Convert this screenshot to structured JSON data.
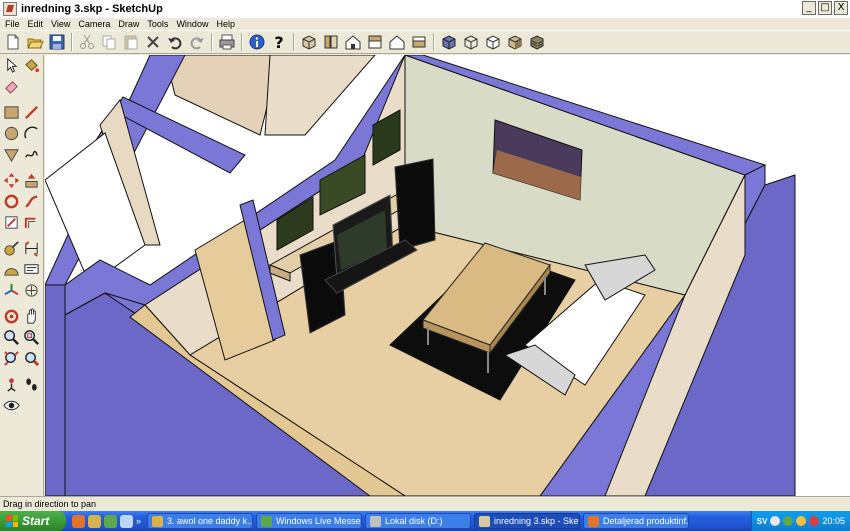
{
  "window": {
    "title": "inredning 3.skp - SketchUp",
    "controls": {
      "minimize": "_",
      "maximize": "□",
      "close": "X"
    }
  },
  "menu": [
    "File",
    "Edit",
    "View",
    "Camera",
    "Draw",
    "Tools",
    "Window",
    "Help"
  ],
  "toolbar": {
    "buttons": [
      "new-icon",
      "open-icon",
      "save-icon",
      "cut-icon",
      "copy-icon",
      "paste-icon",
      "erase-icon",
      "undo-icon",
      "redo-icon",
      "print-icon",
      "model-info-icon",
      "help-icon",
      "iso-view-icon",
      "top-view-icon",
      "front-view-icon",
      "right-view-icon",
      "back-view-icon",
      "left-view-icon",
      "xray-icon",
      "wireframe-icon",
      "hidden-line-icon",
      "shaded-icon",
      "shaded-texture-icon"
    ]
  },
  "palette": {
    "tools": [
      "select-icon",
      "paint-bucket-icon",
      "eraser-icon",
      "rectangle-icon",
      "line-icon",
      "circle-icon",
      "arc-icon",
      "polygon-icon",
      "freehand-icon",
      "move-icon",
      "push-pull-icon",
      "rotate-icon",
      "follow-me-icon",
      "scale-icon",
      "offset-icon",
      "tape-measure-icon",
      "dimension-icon",
      "protractor-icon",
      "text-icon",
      "axes-icon",
      "3d-text-icon",
      "orbit-icon",
      "pan-icon",
      "zoom-icon",
      "zoom-window-icon",
      "zoom-extents-icon",
      "previous-view-icon",
      "position-camera-icon",
      "walk-icon",
      "look-around-icon"
    ]
  },
  "status": {
    "text": "Drag in direction to pan"
  },
  "taskbar": {
    "start_label": "Start",
    "quick_launch_more": "»",
    "tasks": [
      {
        "label": "3. awol one  daddy k...",
        "active": false
      },
      {
        "label": "Windows Live Messen...",
        "active": false
      },
      {
        "label": "Lokal disk (D:)",
        "active": false
      },
      {
        "label": "inredning 3.skp - Sket...",
        "active": true
      },
      {
        "label": "Detaljerad produktinf...",
        "active": false
      }
    ],
    "tray": {
      "language": "SV",
      "clock": "20:05"
    }
  },
  "colors": {
    "wall_top": "#7B77D6",
    "wall_outer": "#6C68C8",
    "interior_wall": "#E9DCC8",
    "back_wall": "#D8DBC6",
    "floor": "#E8CFA3",
    "rug": "#0D0D0D",
    "taskbar_blue": "#245EDC",
    "start_green": "#3A9C36"
  }
}
